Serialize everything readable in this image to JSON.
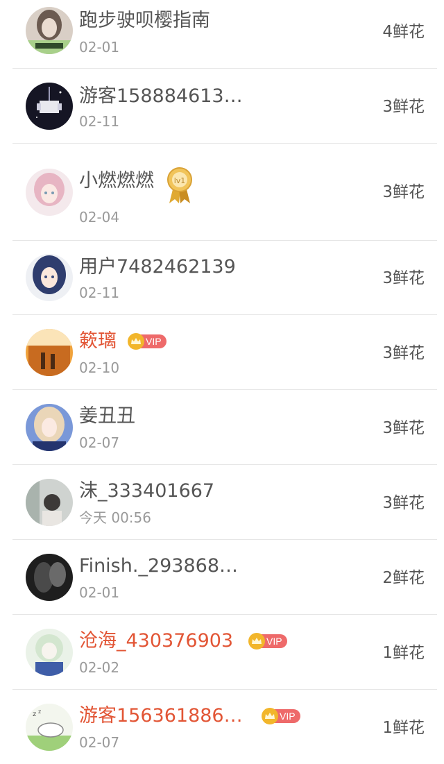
{
  "unit": "鲜花",
  "rows": [
    {
      "name": "跑步驶呗樱指南",
      "date": "02-01",
      "count": "4鲜花",
      "avatar_icon": "avatar-girl-text-icon",
      "badge": "",
      "name_color": "#555555"
    },
    {
      "name": "游客158884613…",
      "date": "02-11",
      "count": "3鲜花",
      "avatar_icon": "avatar-space-icon",
      "badge": "",
      "name_color": "#555555"
    },
    {
      "name": "小燃燃燃",
      "date": "02-04",
      "count": "3鲜花",
      "avatar_icon": "avatar-anime-pink-icon",
      "badge": "lv1",
      "name_color": "#555555"
    },
    {
      "name": "用户7482462139",
      "date": "02-11",
      "count": "3鲜花",
      "avatar_icon": "avatar-anime-blue-icon",
      "badge": "",
      "name_color": "#555555"
    },
    {
      "name": "簌璃",
      "date": "02-10",
      "count": "3鲜花",
      "avatar_icon": "avatar-sunset-icon",
      "badge": "VIP",
      "name_color": "#e25535"
    },
    {
      "name": "姜丑丑",
      "date": "02-07",
      "count": "3鲜花",
      "avatar_icon": "avatar-girl-blonde-icon",
      "badge": "",
      "name_color": "#555555"
    },
    {
      "name": "沫_333401667",
      "date": "今天 00:56",
      "count": "3鲜花",
      "avatar_icon": "avatar-person-icon",
      "badge": "",
      "name_color": "#555555"
    },
    {
      "name": "Finish._293868…",
      "date": "02-01",
      "count": "2鲜花",
      "avatar_icon": "avatar-dark-icon",
      "badge": "",
      "name_color": "#555555"
    },
    {
      "name": "沧海_430376903",
      "date": "02-02",
      "count": "1鲜花",
      "avatar_icon": "avatar-anime-white-icon",
      "badge": "VIP",
      "name_color": "#e25535"
    },
    {
      "name": "游客156361886…",
      "date": "02-07",
      "count": "1鲜花",
      "avatar_icon": "avatar-sleeping-icon",
      "badge": "VIP",
      "name_color": "#e25535"
    }
  ],
  "colors": {
    "vip_name": "#e25535",
    "vip_tag": "#ee6a6a",
    "crown": "#f2b62b",
    "divider": "#e6e6e6"
  }
}
